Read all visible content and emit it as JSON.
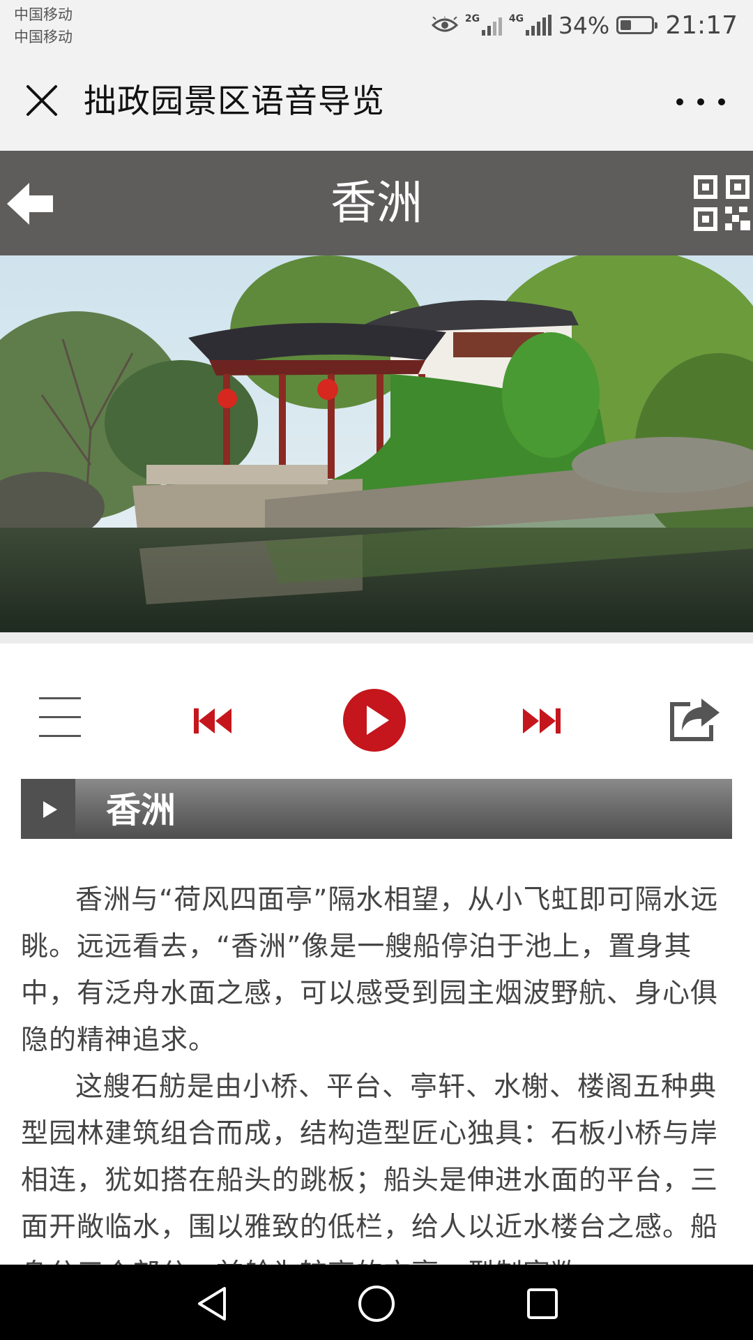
{
  "status_bar": {
    "carrier_1": "中国移动",
    "carrier_2": "中国移动",
    "sim1_network": "2G",
    "sim2_network": "4G",
    "battery_percent": "34%",
    "battery_level": 0.34,
    "time": "21:17",
    "icons": [
      "eye-icon",
      "signal-icon",
      "battery-icon"
    ]
  },
  "wechat_nav": {
    "title": "拙政园景区语音导览",
    "close_icon": "close-icon",
    "more_icon": "more-icon"
  },
  "page_header": {
    "title": "香洲",
    "back_icon": "back-arrow-icon",
    "qr_icon": "qr-code-icon",
    "color": "#5f5c5c"
  },
  "photo": {
    "icon": "pavilion-photo"
  },
  "player": {
    "icons": [
      "playlist-icon",
      "previous-icon",
      "play-icon",
      "next-icon",
      "share-icon"
    ],
    "accent": "#c4161c"
  },
  "section": {
    "title": "香洲"
  },
  "article": {
    "paragraphs": [
      "香洲与“荷风四面亭”隔水相望，从小飞虹即可隔水远眺。远远看去，“香洲”像是一艘船停泊于池上，置身其中，有泛舟水面之感，可以感受到园主烟波野航、身心俱隐的精神追求。",
      "这艘石舫是由小桥、平台、亭轩、水榭、楼阁五种典型园林建筑组合而成，结构造型匠心独具：石板小桥与岸相连，犹如搭在船头的跳板；船头是伸进水面的平台，三面开敞临水，围以雅致的低栏，给人以近水楼台之感。船身分三个部分，前舱为较高的方亭，型制宽敞"
    ]
  },
  "nav_bar": {
    "icons": [
      "nav-back-icon",
      "nav-home-icon",
      "nav-recent-icon"
    ]
  }
}
